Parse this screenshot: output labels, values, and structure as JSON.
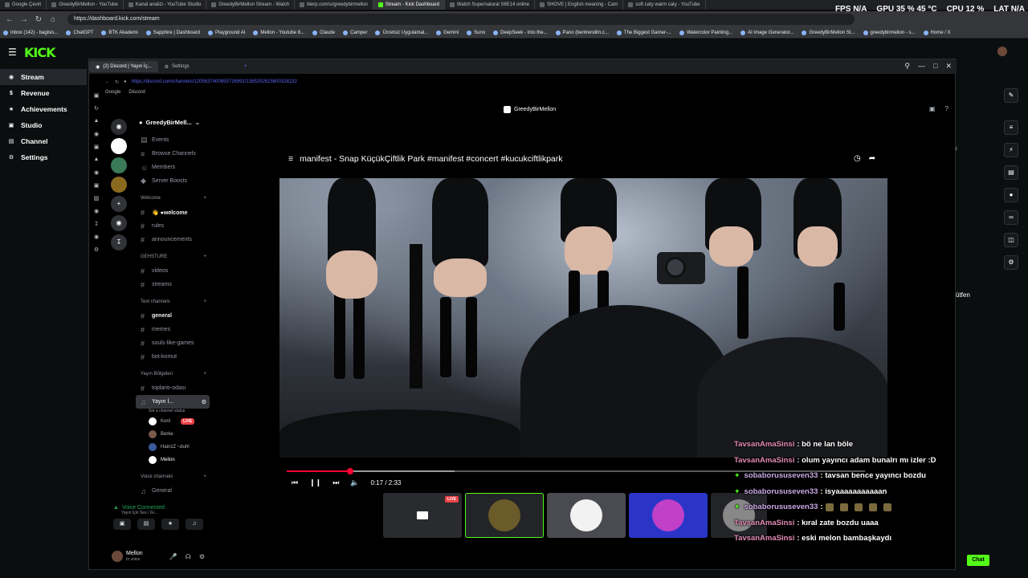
{
  "browser": {
    "tabs": [
      {
        "label": "Google Çeviri",
        "active": false
      },
      {
        "label": "GreedyBirMellon - YouTube",
        "active": false
      },
      {
        "label": "Kanal analizi - YouTube Studio",
        "active": false
      },
      {
        "label": "GreedyBirMellon Stream - Watch",
        "active": false
      },
      {
        "label": "blerp.com/u/greedybirmellon",
        "active": false
      },
      {
        "label": "Stream - Kick Dashboard",
        "active": true
      },
      {
        "label": "Watch Supernatural S6E14 online",
        "active": false
      },
      {
        "label": "SHOVE | English meaning - Cam",
        "active": false
      },
      {
        "label": "soft caty warm caty - YouTube",
        "active": false
      }
    ],
    "url": "https://dashboard.kick.com/stream",
    "bookmarks": [
      "Inbox (142) - bagisis...",
      "ChatGPT",
      "BTK Akademi",
      "Sapphire | Dashboard",
      "Playground AI",
      "Mellon - Youtube 8...",
      "Claude",
      "Camper",
      "Ücretsiz Uygulamal...",
      "Gemini",
      "Suno",
      "DeepSeek - Into the...",
      "Pano (bentrendim.c...",
      "The Biggest Gamer-...",
      "Watercolor Painting...",
      "AI Image Generator...",
      "GreedyBirMellon St...",
      "greedybirmellon - s...",
      "Home / X"
    ]
  },
  "perf_overlay": {
    "fps_label": "FPS",
    "fps_value": "N/A",
    "gpu_label": "GPU",
    "gpu_value": "35 % 45 °C",
    "cpu_label": "CPU",
    "cpu_value": "12 %",
    "lat_label": "LAT",
    "lat_value": "N/A"
  },
  "kick": {
    "logo": "KICK",
    "nav": [
      {
        "label": "Stream",
        "icon": "broadcast-icon",
        "active": true
      },
      {
        "label": "Revenue",
        "icon": "dollar-icon",
        "active": false
      },
      {
        "label": "Achievements",
        "icon": "trophy-icon",
        "active": false
      },
      {
        "label": "Studio",
        "icon": "studio-icon",
        "active": false
      },
      {
        "label": "Channel",
        "icon": "channel-icon",
        "active": false
      },
      {
        "label": "Settings",
        "icon": "gear-icon",
        "active": false
      }
    ],
    "right_fragments": {
      "k": "k",
      "utfen": "ütfen"
    },
    "chat_button": "Chat",
    "accent": "#53fc18"
  },
  "discord": {
    "window_tabs": [
      "(2) Discord | Yayın İç...",
      "Settings"
    ],
    "url": "https://discord.com/channels/1205637400853716992/1385292615800328232",
    "bookmarks": [
      "Google",
      "Discord"
    ],
    "server_name": "GreedyBirMell...",
    "menu": [
      "Events",
      "Browse Channels",
      "Members",
      "Server Boosts"
    ],
    "categories": [
      {
        "name": "Welcome",
        "channels": [
          "👋 ●welcome",
          "rules",
          "announcements"
        ]
      },
      {
        "name": "GEHSTURE",
        "channels": [
          "videos",
          "streams"
        ]
      },
      {
        "name": "Text channels",
        "channels": [
          "general",
          "memes",
          "souls-like-games",
          "bot-komut"
        ]
      },
      {
        "name": "Yayın Bölgeleri",
        "channels": [
          "toplantı-odası",
          "Yayın İ..."
        ]
      }
    ],
    "voice_sub": "Set a channel status",
    "voice_users": [
      {
        "name": "Korii",
        "live": "LIVE"
      },
      {
        "name": "Berke",
        "live": ""
      },
      {
        "name": "HainzZ ~duh!",
        "live": ""
      },
      {
        "name": "Mellon",
        "live": ""
      }
    ],
    "voice_channels_label": "Voice channels",
    "voice_general": "General",
    "voice_connected": "Voice Connected",
    "voice_connected_sub": "Yayın İçin Ses / Gr...",
    "user": {
      "name": "Mellon",
      "status": "In voice"
    },
    "stage_title": "GreedyBirMellon",
    "video_title": "manifest - Snap KüçükÇiftlik Park #manifest #concert #kucukciftlikpark",
    "video_time": "0:17 / 2:33",
    "video_progress": 0.11,
    "video_loaded": 0.29,
    "thumb_live": "LIVE"
  },
  "chat_overlay": [
    {
      "user": "TavsanAmaSinsi",
      "badge": false,
      "text": ": bö ne lan böle"
    },
    {
      "user": "TavsanAmaSinsi",
      "badge": false,
      "text": ": olum yayıncı adam bunalrı mı izler :D"
    },
    {
      "user": "sobaborususeven33",
      "badge": true,
      "text": ": tavsan bence yayıncı bozdu"
    },
    {
      "user": "sobaborususeven33",
      "badge": true,
      "text": ": isyaaaaaaaaaaan"
    },
    {
      "user": "sobaborususeven33",
      "badge": true,
      "text": ":"
    },
    {
      "user": "TavsanAmaSinsi",
      "badge": false,
      "text": ": kıral zate bozdu uaaa"
    },
    {
      "user": "TavsanAmaSinsi",
      "badge": false,
      "text": ": eski melon bambaşkaydı"
    }
  ]
}
